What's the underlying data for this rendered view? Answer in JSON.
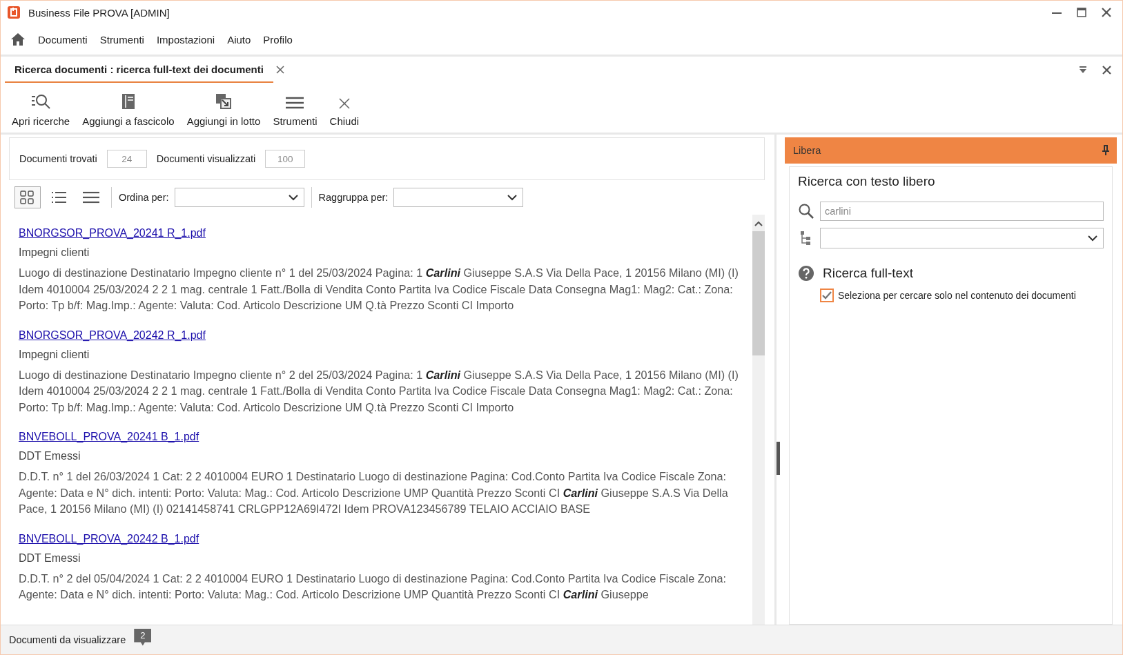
{
  "window": {
    "title": "Business File PROVA [ADMIN]"
  },
  "menu": [
    "Documenti",
    "Strumenti",
    "Impostazioni",
    "Aiuto",
    "Profilo"
  ],
  "document_tab": {
    "label": "Ricerca documenti : ricerca full-text dei documenti",
    "selected": true
  },
  "toolbar": [
    {
      "kind": "search",
      "label": "Apri ricerche"
    },
    {
      "kind": "binder",
      "label": "Aggiungi a fascicolo"
    },
    {
      "kind": "batch",
      "label": "Aggiungi in lotto"
    },
    {
      "kind": "menu",
      "label": "Strumenti"
    },
    {
      "kind": "close",
      "label": "Chiudi"
    }
  ],
  "counters": [
    {
      "label": "Documenti trovati",
      "value": "24"
    },
    {
      "label": "Documenti visualizzati",
      "value": "100"
    }
  ],
  "view_modes": [
    {
      "kind": "grid",
      "selected": true
    },
    {
      "kind": "list",
      "selected": false
    },
    {
      "kind": "lines",
      "selected": false
    }
  ],
  "sort": {
    "label": "Ordina per:"
  },
  "group": {
    "label": "Raggruppa per:"
  },
  "results": [
    {
      "file": "BNORGSOR_PROVA_20241 R_1.pdf",
      "category": "Impegni clienti",
      "snippet": "Luogo di destinazione Destinatario Impegno cliente n° 1 del 25/03/2024 Pagina: 1 **Carlini** Giuseppe S.A.S Via Della Pace, 1 20156 Milano (MI) (I) Idem 4010004 25/03/2024 2 2 1 mag. centrale 1 Fatt./Bolla di Vendita Conto Partita Iva Codice Fiscale Data Consegna Mag1: Mag2: Cat.: Zona: Porto: Tp b/f: Mag.Imp.: Agente: Valuta: Cod. Articolo Descrizione UM Q.tà Prezzo Sconti CI Importo"
    },
    {
      "file": "BNORGSOR_PROVA_20242 R_1.pdf",
      "category": "Impegni clienti",
      "snippet": "Luogo di destinazione Destinatario Impegno cliente n° 2 del 25/03/2024 Pagina: 1 **Carlini** Giuseppe S.A.S Via Della Pace, 1 20156 Milano (MI) (I) Idem 4010004 25/03/2024 2 2 1 mag. centrale 1 Fatt./Bolla di Vendita Conto Partita Iva Codice Fiscale Data Consegna Mag1: Mag2: Cat.: Zona: Porto: Tp b/f: Mag.Imp.: Agente: Valuta: Cod. Articolo Descrizione UM Q.tà Prezzo Sconti CI Importo"
    },
    {
      "file": "BNVEBOLL_PROVA_20241 B_1.pdf",
      "category": "DDT Emessi",
      "snippet": "D.D.T. n° 1 del 26/03/2024 1 Cat: 2 2 4010004 EURO 1 Destinatario Luogo di destinazione Pagina: Cod.Conto Partita Iva Codice Fiscale Zona: Agente: Data e N° dich. intenti: Porto: Valuta: Mag.: Cod. Articolo Descrizione UMP Quantità Prezzo Sconti CI **Carlini** Giuseppe S.A.S Via Della Pace, 1 20156 Milano (MI) (I) 02141458741 CRLGPP12A69I472I Idem PROVA123456789 TELAIO ACCIAIO BASE"
    },
    {
      "file": "BNVEBOLL_PROVA_20242 B_1.pdf",
      "category": "DDT Emessi",
      "snippet": "D.D.T. n° 2 del 05/04/2024 1 Cat: 2 2 4010004 EURO 1 Destinatario Luogo di destinazione Pagina: Cod.Conto Partita Iva Codice Fiscale Zona: Agente: Data e N° dich. intenti: Porto: Valuta: Mag.: Cod. Articolo Descrizione UMP Quantità Prezzo Sconti CI **Carlini** Giuseppe"
    }
  ],
  "side_panel": {
    "title": "Libera",
    "heading": "Ricerca con testo libero",
    "search_value": "carlini",
    "section": "Ricerca full-text",
    "checkbox": {
      "label": "Seleziona per cercare solo nel contenuto dei documenti",
      "checked": true
    }
  },
  "status_bar": {
    "label": "Documenti da visualizzare",
    "badge": "2"
  }
}
